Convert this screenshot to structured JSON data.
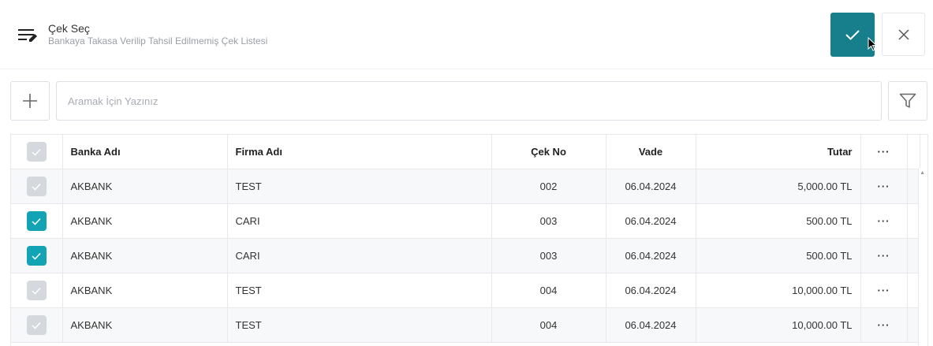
{
  "header": {
    "title": "Çek Seç",
    "subtitle": "Bankaya Takasa Verilip Tahsil Edilmemiş Çek Listesi"
  },
  "toolbar": {
    "search_placeholder": "Aramak İçin Yazınız"
  },
  "colors": {
    "accent": "#177f8c",
    "checkbox_checked": "#12a3b5",
    "checkbox_unchecked": "#d5d8dd"
  },
  "table": {
    "columns": {
      "bank": "Banka Adı",
      "company": "Firma Adı",
      "check_no": "Çek No",
      "due": "Vade",
      "amount": "Tutar",
      "more": "···"
    },
    "rows": [
      {
        "checked": false,
        "bank": "AKBANK",
        "company": "TEST",
        "check_no": "002",
        "due": "06.04.2024",
        "amount": "5,000.00 TL",
        "more": "···"
      },
      {
        "checked": true,
        "bank": "AKBANK",
        "company": "CARI",
        "check_no": "003",
        "due": "06.04.2024",
        "amount": "500.00 TL",
        "more": "···"
      },
      {
        "checked": true,
        "bank": "AKBANK",
        "company": "CARI",
        "check_no": "003",
        "due": "06.04.2024",
        "amount": "500.00 TL",
        "more": "···"
      },
      {
        "checked": false,
        "bank": "AKBANK",
        "company": "TEST",
        "check_no": "004",
        "due": "06.04.2024",
        "amount": "10,000.00 TL",
        "more": "···"
      },
      {
        "checked": false,
        "bank": "AKBANK",
        "company": "TEST",
        "check_no": "004",
        "due": "06.04.2024",
        "amount": "10,000.00 TL",
        "more": "···"
      }
    ]
  }
}
